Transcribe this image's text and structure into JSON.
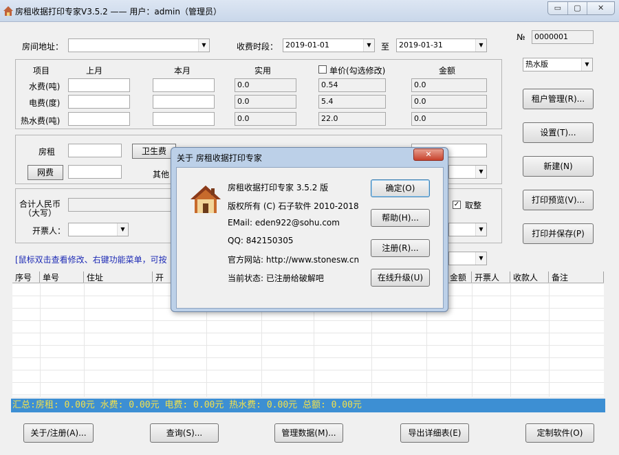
{
  "window": {
    "title": "房租收据打印专家V3.5.2 —— 用户：admin（管理员）"
  },
  "header": {
    "room_label": "房间地址：",
    "period_label": "收费时段：",
    "date_from": "2019-01-01",
    "to_label": "至",
    "date_to": "2019-01-31",
    "no_label": "№",
    "receipt_no": "0000001",
    "version_select": "热水版"
  },
  "fees": {
    "col_item": "项目",
    "col_last": "上月",
    "col_this": "本月",
    "col_actual": "实用",
    "col_unit": "单价(勾选修改)",
    "col_amount": "金额",
    "rows": [
      {
        "label": "水费(吨)",
        "actual": "0.0",
        "unit": "0.54",
        "amount": "0.0"
      },
      {
        "label": "电费(度)",
        "actual": "0.0",
        "unit": "5.4",
        "amount": "0.0"
      },
      {
        "label": "热水费(吨)",
        "actual": "0.0",
        "unit": "22.0",
        "amount": "0.0"
      }
    ]
  },
  "other": {
    "rent_label": "房租",
    "sanitation_label": "卫生费",
    "net_label": "网费",
    "misc_label": "其他",
    "total_label_1": "合计人民币",
    "total_label_2": "（大写）",
    "round_label": "取整",
    "issuer_label": "开票人："
  },
  "hint": "[鼠标双击查看修改、右键功能菜单，可按",
  "table": {
    "headers": [
      "序号",
      "单号",
      "住址",
      "开",
      "金额",
      "开票人",
      "收款人",
      "备注"
    ]
  },
  "summary": "汇总:房租: 0.00元  水费: 0.00元  电费: 0.00元  热水费: 0.00元  总额: 0.00元",
  "side_buttons": [
    "租户管理(R)...",
    "设置(T)...",
    "新建(N)",
    "打印预览(V)...",
    "打印并保存(P)"
  ],
  "bottom_buttons": [
    "关于/注册(A)...",
    "查询(S)...",
    "管理数据(M)...",
    "导出详细表(E)",
    "定制软件(O)"
  ],
  "dialog": {
    "title": "关于 房租收据打印专家",
    "line1": "房租收据打印专家 3.5.2 版",
    "line2": "版权所有 (C) 石子软件 2010-2018",
    "line3": "EMail: eden922@sohu.com",
    "line4": "QQ:  842150305",
    "line5": "官方网站: http://www.stonesw.cn",
    "line6": "当前状态: 已注册给破解吧",
    "ok": "确定(O)",
    "help": "帮助(H)...",
    "register": "注册(R)...",
    "upgrade": "在线升级(U)"
  }
}
